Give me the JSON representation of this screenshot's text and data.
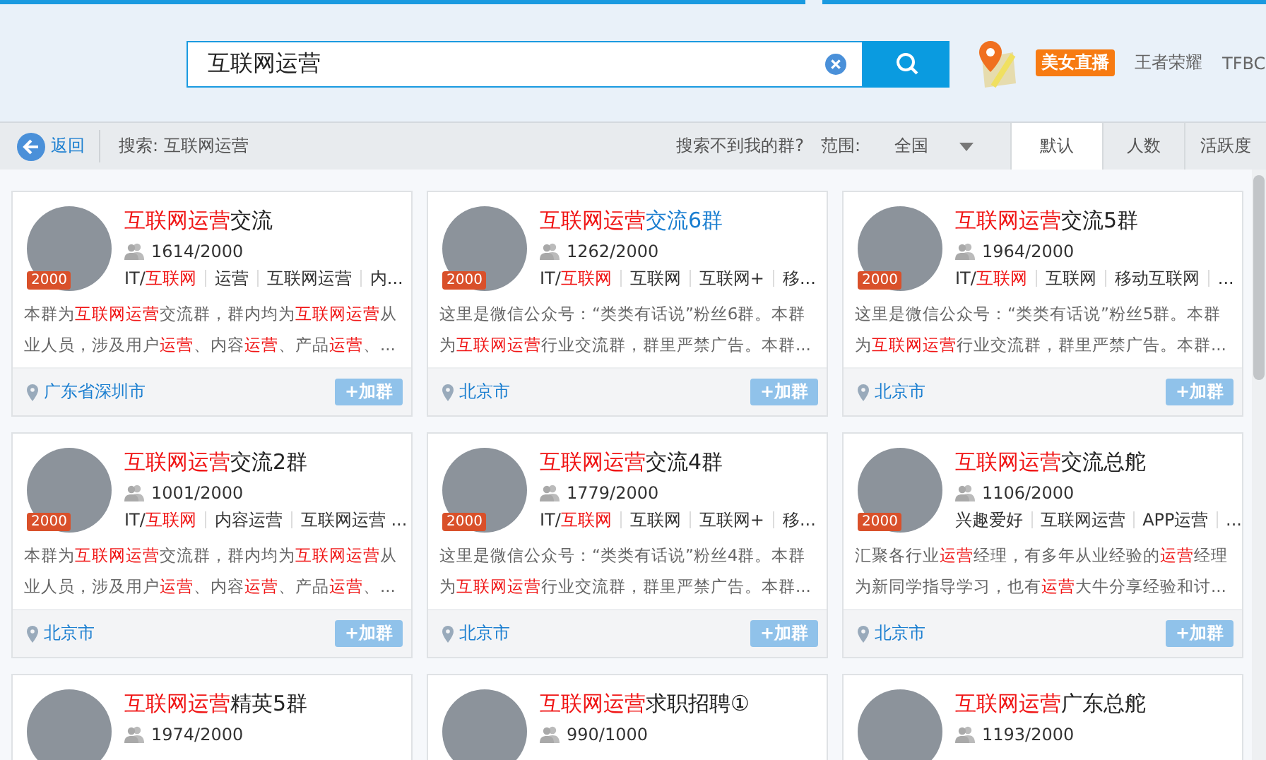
{
  "search": {
    "value": "互联网运营"
  },
  "header_links": [
    {
      "label": "美女直播",
      "kind": "badge"
    },
    {
      "label": "王者荣耀",
      "kind": "link"
    },
    {
      "label": "TFBC",
      "kind": "link"
    }
  ],
  "toolbar": {
    "back": "返回",
    "query": "搜索: 互联网运营",
    "help": "搜索不到我的群?",
    "scope_label": "范围:",
    "scope_value": "全国",
    "sort_tabs": [
      {
        "label": "默认",
        "selected": true
      },
      {
        "label": "人数",
        "selected": false
      },
      {
        "label": "活跃度",
        "selected": false
      }
    ]
  },
  "cards": [
    {
      "badge": "2000",
      "hovered": false,
      "title": [
        {
          "t": "互联网运营",
          "hl": true
        },
        {
          "t": "交流"
        }
      ],
      "members": "1614/2000",
      "tags": [
        [
          {
            "t": "IT/"
          },
          {
            "t": "互联网",
            "hl": true
          }
        ],
        [
          {
            "t": "运营"
          }
        ],
        [
          {
            "t": "互联网运营"
          }
        ],
        [
          {
            "t": "内..."
          }
        ]
      ],
      "description": [
        {
          "t": "本群为"
        },
        {
          "t": "互联网运营",
          "hl": true
        },
        {
          "t": "交流群，群内均为"
        },
        {
          "t": "互联网运营",
          "hl": true
        },
        {
          "t": "从业人员，涉及用户"
        },
        {
          "t": "运营",
          "hl": true
        },
        {
          "t": "、内容"
        },
        {
          "t": "运营",
          "hl": true
        },
        {
          "t": "、产品"
        },
        {
          "t": "运营",
          "hl": true
        },
        {
          "t": "、..."
        }
      ],
      "location": "广东省深圳市",
      "join": "+加群"
    },
    {
      "badge": "2000",
      "hovered": true,
      "title": [
        {
          "t": "互联网运营",
          "hl": true
        },
        {
          "t": "交流6群"
        }
      ],
      "members": "1262/2000",
      "tags": [
        [
          {
            "t": "IT/"
          },
          {
            "t": "互联网",
            "hl": true
          }
        ],
        [
          {
            "t": "互联网"
          }
        ],
        [
          {
            "t": "互联网+"
          }
        ],
        [
          {
            "t": "移..."
          }
        ]
      ],
      "description": [
        {
          "t": "这里是微信公众号：“类类有话说”粉丝6群。本群为"
        },
        {
          "t": "互联网运营",
          "hl": true
        },
        {
          "t": "行业交流群，群里严禁广告。本群..."
        }
      ],
      "location": "北京市",
      "join": "+加群"
    },
    {
      "badge": "2000",
      "hovered": false,
      "title": [
        {
          "t": "互联网运营",
          "hl": true
        },
        {
          "t": "交流5群"
        }
      ],
      "members": "1964/2000",
      "tags": [
        [
          {
            "t": "IT/"
          },
          {
            "t": "互联网",
            "hl": true
          }
        ],
        [
          {
            "t": "互联网"
          }
        ],
        [
          {
            "t": "移动互联网"
          }
        ],
        [
          {
            "t": "..."
          }
        ]
      ],
      "description": [
        {
          "t": "这里是微信公众号：“类类有话说”粉丝5群。本群为"
        },
        {
          "t": "互联网运营",
          "hl": true
        },
        {
          "t": "行业交流群，群里严禁广告。本群..."
        }
      ],
      "location": "北京市",
      "join": "+加群"
    },
    {
      "badge": "2000",
      "hovered": false,
      "title": [
        {
          "t": "互联网运营",
          "hl": true
        },
        {
          "t": "交流2群"
        }
      ],
      "members": "1001/2000",
      "tags": [
        [
          {
            "t": "IT/"
          },
          {
            "t": "互联网",
            "hl": true
          }
        ],
        [
          {
            "t": "内容运营"
          }
        ],
        [
          {
            "t": "互联网运营 ..."
          }
        ]
      ],
      "description": [
        {
          "t": "本群为"
        },
        {
          "t": "互联网运营",
          "hl": true
        },
        {
          "t": "交流群，群内均为"
        },
        {
          "t": "互联网运营",
          "hl": true
        },
        {
          "t": "从业人员，涉及用户"
        },
        {
          "t": "运营",
          "hl": true
        },
        {
          "t": "、内容"
        },
        {
          "t": "运营",
          "hl": true
        },
        {
          "t": "、产品"
        },
        {
          "t": "运营",
          "hl": true
        },
        {
          "t": "、..."
        }
      ],
      "location": "北京市",
      "join": "+加群"
    },
    {
      "badge": "2000",
      "hovered": false,
      "title": [
        {
          "t": "互联网运营",
          "hl": true
        },
        {
          "t": "交流4群"
        }
      ],
      "members": "1779/2000",
      "tags": [
        [
          {
            "t": "IT/"
          },
          {
            "t": "互联网",
            "hl": true
          }
        ],
        [
          {
            "t": "互联网"
          }
        ],
        [
          {
            "t": "互联网+"
          }
        ],
        [
          {
            "t": "移..."
          }
        ]
      ],
      "description": [
        {
          "t": "这里是微信公众号：“类类有话说”粉丝4群。本群为"
        },
        {
          "t": "互联网运营",
          "hl": true
        },
        {
          "t": "行业交流群，群里严禁广告。本群..."
        }
      ],
      "location": "北京市",
      "join": "+加群"
    },
    {
      "badge": "2000",
      "hovered": false,
      "title": [
        {
          "t": "互联网运营",
          "hl": true
        },
        {
          "t": "交流总舵"
        }
      ],
      "members": "1106/2000",
      "tags": [
        [
          {
            "t": "兴趣爱好"
          }
        ],
        [
          {
            "t": "互联网运营"
          }
        ],
        [
          {
            "t": "APP运营"
          }
        ],
        [
          {
            "t": "..."
          }
        ]
      ],
      "description": [
        {
          "t": "汇聚各行业"
        },
        {
          "t": "运营",
          "hl": true
        },
        {
          "t": "经理，有多年从业经验的"
        },
        {
          "t": "运营",
          "hl": true
        },
        {
          "t": "经理为新同学指导学习，也有"
        },
        {
          "t": "运营",
          "hl": true
        },
        {
          "t": "大牛分享经验和讨..."
        }
      ],
      "location": "北京市",
      "join": "+加群"
    },
    {
      "hovered": false,
      "title": [
        {
          "t": "互联网运营",
          "hl": true
        },
        {
          "t": "精英5群"
        }
      ],
      "members": "1974/2000"
    },
    {
      "hovered": false,
      "title": [
        {
          "t": "互联网运营",
          "hl": true
        },
        {
          "t": "求职招聘①"
        }
      ],
      "members": "990/1000"
    },
    {
      "hovered": false,
      "title": [
        {
          "t": "互联网运营",
          "hl": true
        },
        {
          "t": "广东总舵"
        }
      ],
      "members": "1193/2000"
    }
  ]
}
